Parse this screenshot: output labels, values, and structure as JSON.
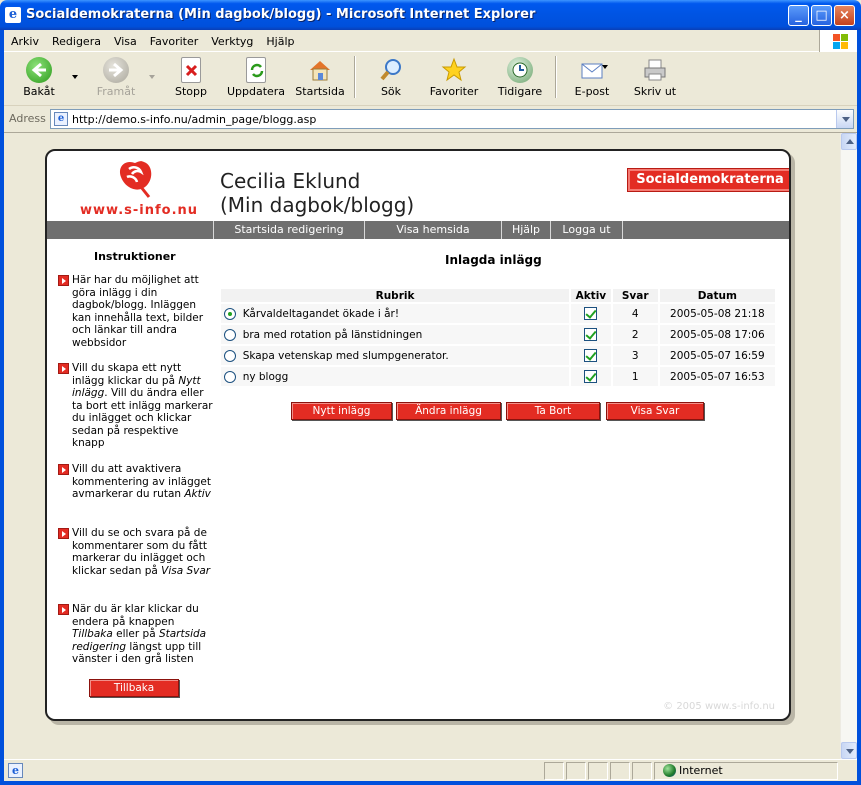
{
  "window": {
    "title": "Socialdemokraterna (Min dagbok/blogg) - Microsoft Internet Explorer",
    "minimize": "_",
    "maximize": "□",
    "close": "×",
    "app_icon": "e"
  },
  "menu": [
    "Arkiv",
    "Redigera",
    "Visa",
    "Favoriter",
    "Verktyg",
    "Hjälp"
  ],
  "toolbar": {
    "back": "Bakåt",
    "forward": "Framåt",
    "stop": "Stopp",
    "refresh": "Uppdatera",
    "home": "Startsida",
    "search": "Sök",
    "favorites": "Favoriter",
    "history": "Tidigare",
    "mail": "E-post",
    "print": "Skriv ut"
  },
  "address": {
    "label": "Adress",
    "url": "http://demo.s-info.nu/admin_page/blogg.asp"
  },
  "page": {
    "logo_text": "www.s-info.nu",
    "owner_name": "Cecilia Eklund",
    "subtitle": "(Min dagbok/blogg)",
    "brand_badge": "Socialdemokraterna",
    "nav": [
      "Startsida redigering",
      "Visa hemsida",
      "Hjälp",
      "Logga ut"
    ],
    "instructions_title": "Instruktioner",
    "instructions": [
      [
        "Här har du möjlighet att göra inlägg i din dagbok/blogg. Inläggen kan innehålla text, bilder och länkar till andra webbsidor"
      ],
      [
        "Vill du skapa ett nytt inlägg klickar du på ",
        "Nytt inlägg",
        ". Vill du ändra eller ta bort ett inlägg markerar du inlägget och klickar sedan på respektive knapp"
      ],
      [
        "Vill du att avaktivera kommentering av inlägget avmarkerar du rutan ",
        "Aktiv",
        ""
      ],
      [
        "Vill du se och svara på de kommentarer som du fått markerar du inlägget och klickar sedan på ",
        "Visa Svar",
        ""
      ],
      [
        "När du är klar klickar du endera på knappen ",
        "Tillbaka",
        " eller på ",
        "Startsida redigering",
        " längst upp till vänster i den grå listen"
      ]
    ],
    "back_button": "Tillbaka",
    "section_title": "Inlagda inlägg",
    "table": {
      "headers": [
        "Rubrik",
        "Aktiv",
        "Svar",
        "Datum"
      ],
      "rows": [
        {
          "title": "Kårvaldeltagandet ökade i år!",
          "active": true,
          "replies": "4",
          "date": "2005-05-08 21:18",
          "selected": true
        },
        {
          "title": "bra med rotation på länstidningen",
          "active": true,
          "replies": "2",
          "date": "2005-05-08 17:06",
          "selected": false
        },
        {
          "title": "Skapa vetenskap med slumpgenerator.",
          "active": true,
          "replies": "3",
          "date": "2005-05-07 16:59",
          "selected": false
        },
        {
          "title": "ny blogg",
          "active": true,
          "replies": "1",
          "date": "2005-05-07 16:53",
          "selected": false
        }
      ]
    },
    "actions": [
      "Nytt inlägg",
      "Ändra inlägg",
      "Ta Bort",
      "Visa Svar"
    ],
    "copyright": "© 2005 www.s-info.nu"
  },
  "status": {
    "zone": "Internet"
  },
  "colors": {
    "brand_red": "#E32C23",
    "nav_gray": "#6F6F6F",
    "xp_blue": "#0054E3"
  }
}
